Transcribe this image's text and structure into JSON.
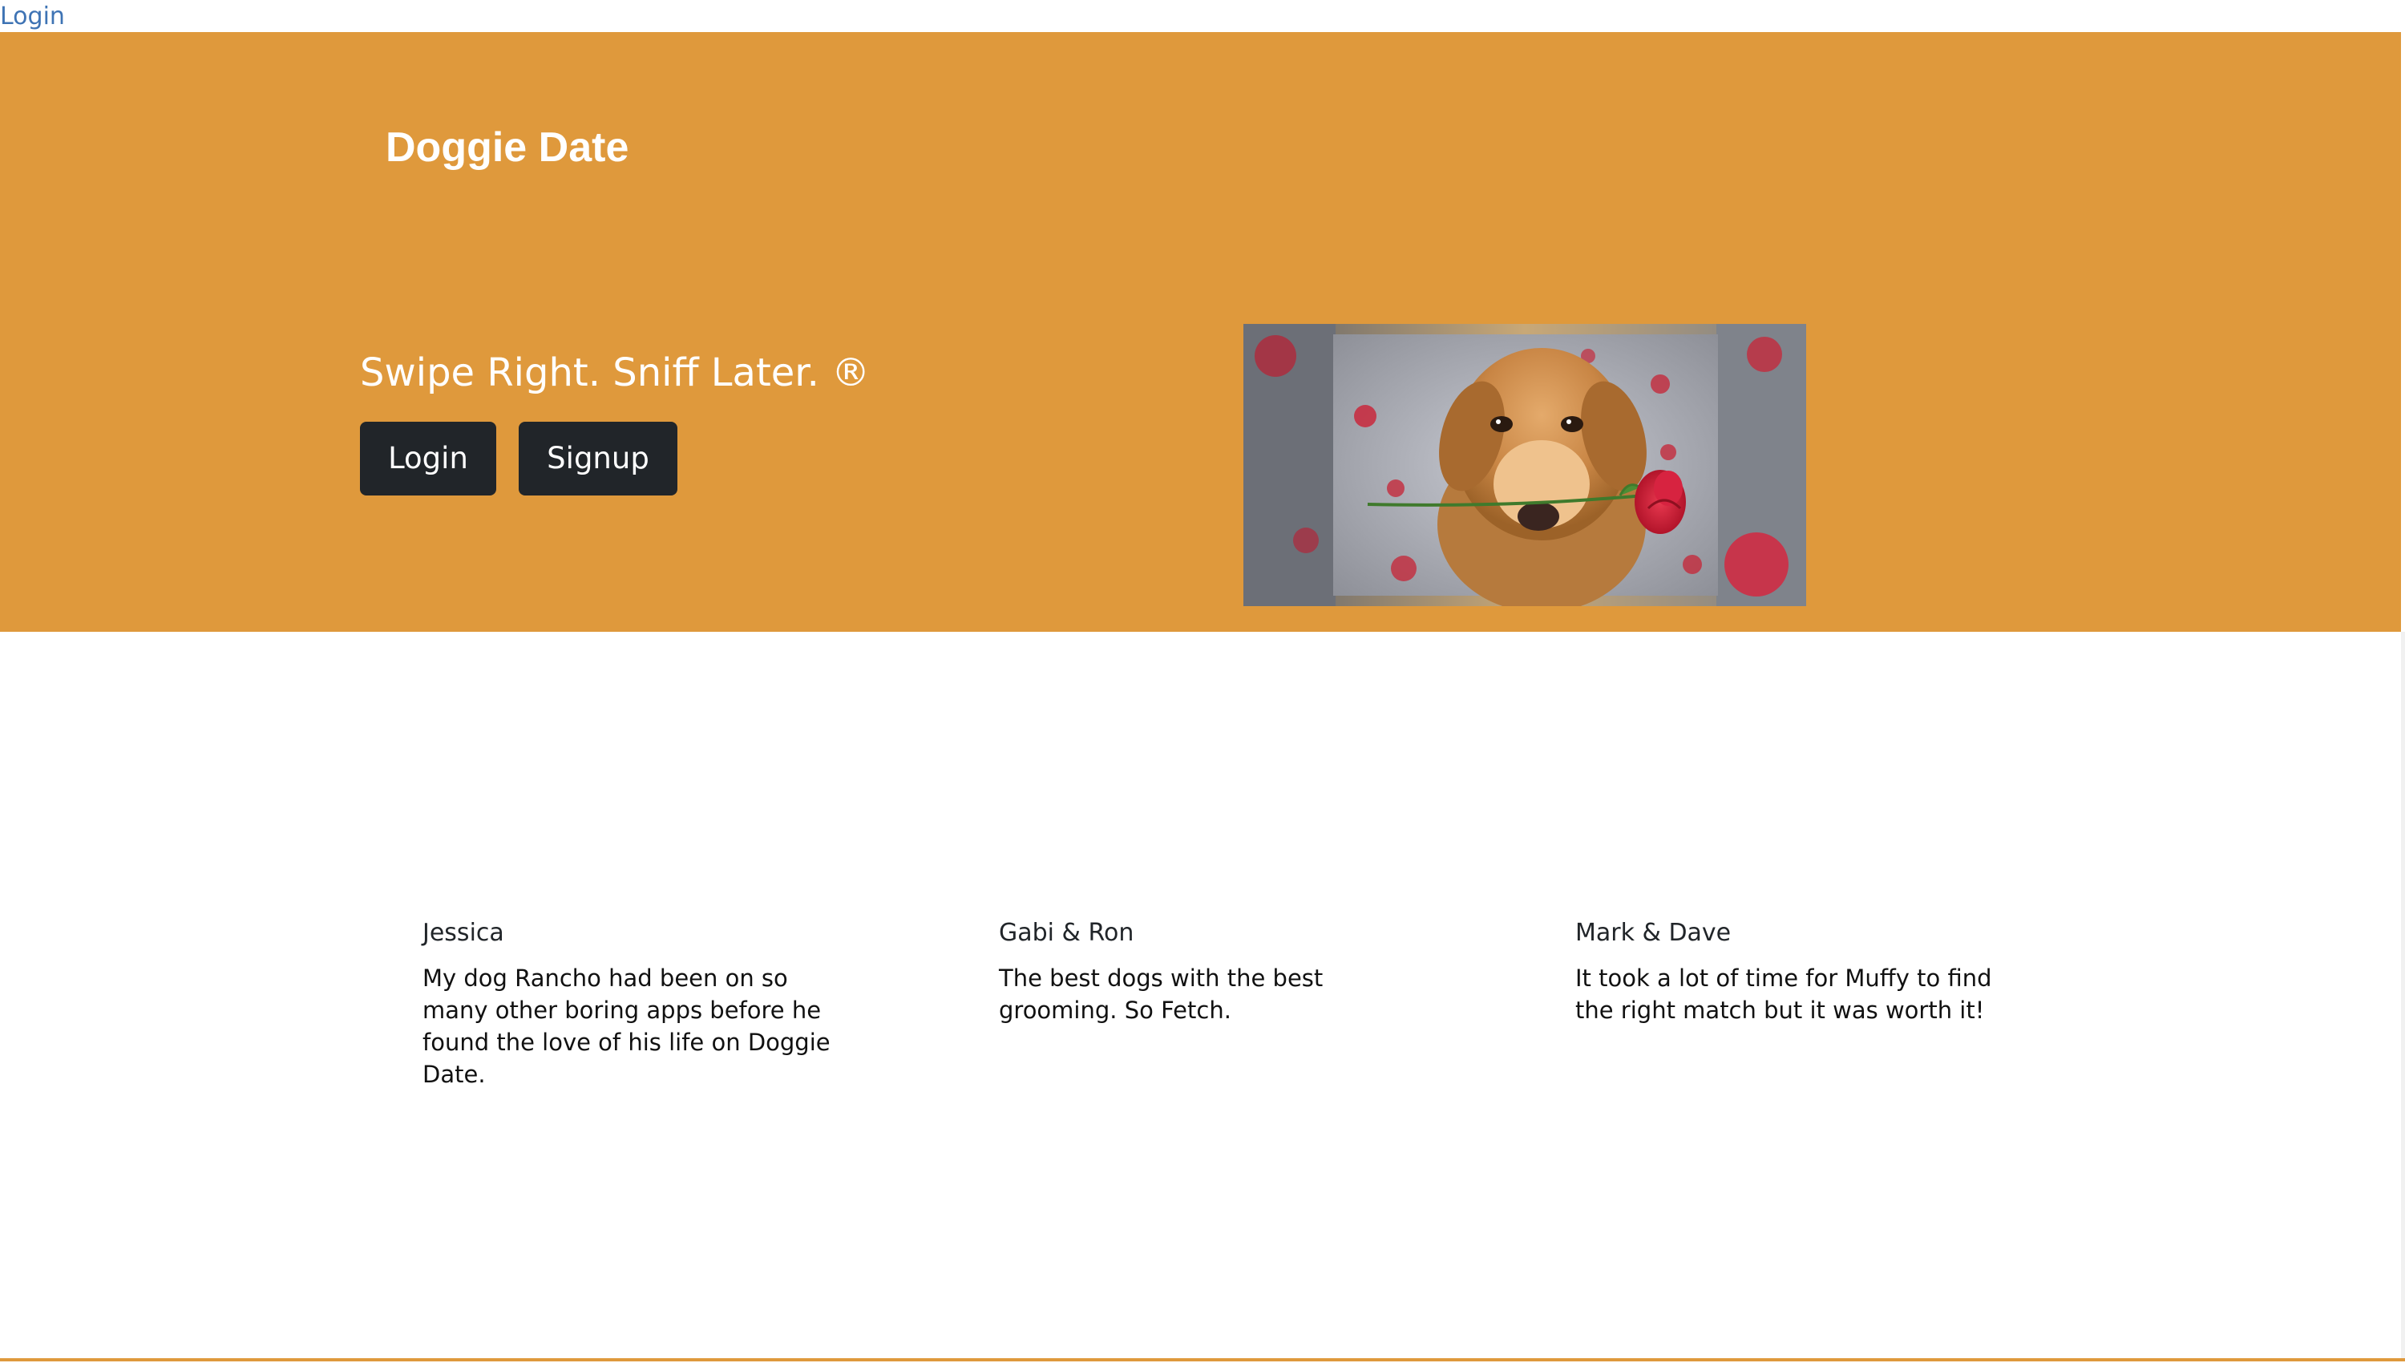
{
  "top_nav": {
    "login_link": "Login"
  },
  "hero": {
    "brand": "Doggie Date",
    "tagline": "Swipe Right. Sniff Later. ®",
    "login_button": "Login",
    "signup_button": "Signup",
    "accent_color": "#df993c",
    "button_color": "#212529"
  },
  "testimonials": [
    {
      "name": "Jessica",
      "quote": "My dog Rancho had been on so many other boring apps before he found the love of his life on Doggie Date."
    },
    {
      "name": "Gabi & Ron",
      "quote": "The best dogs with the best grooming. So Fetch."
    },
    {
      "name": "Mark & Dave",
      "quote": "It took a lot of time for Muffy to find the right match but it was worth it!"
    }
  ]
}
